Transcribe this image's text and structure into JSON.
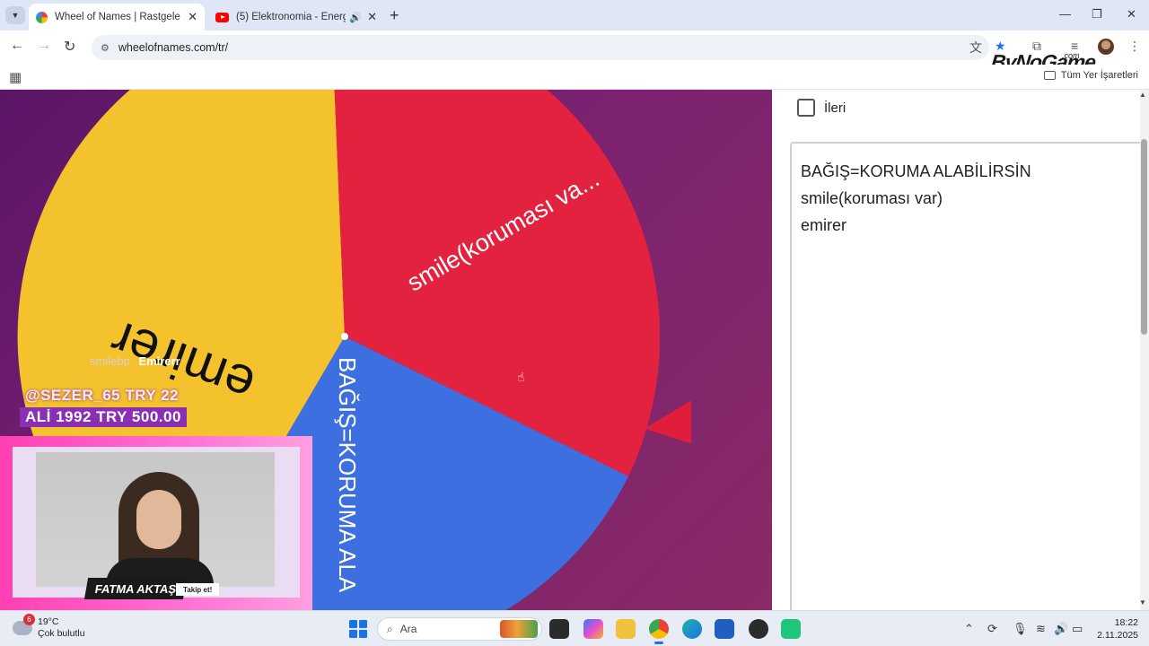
{
  "browser": {
    "tabs": [
      {
        "title": "Wheel of Names | Rastgele",
        "active": true
      },
      {
        "title": "(5) Elektronomia - Energy |",
        "active": false
      }
    ],
    "url": "wheelofnames.com/tr/",
    "bookmarks_bar": {
      "all_bookmarks_label": "Tüm Yer İşaretleri"
    },
    "watermark": {
      "brand": "ByNoGame",
      "suffix": ".com"
    }
  },
  "wheel": {
    "segments": [
      {
        "label": "emirer",
        "color": "#f3c22d"
      },
      {
        "label": "smile(koruması va...",
        "color": "#e3223f"
      },
      {
        "label": "BAĞIŞ=KORUMA ALA",
        "color": "#3d6fe0"
      }
    ],
    "pointer_color": "#e01e3c",
    "background_colors": [
      "#5b1566",
      "#8a2a66"
    ]
  },
  "stream_overlay": {
    "chat": {
      "user": "smilebp",
      "message": "Emirerr"
    },
    "donations": [
      "@SEZER_65  TRY 22",
      "ALİ 1992  TRY 500.00"
    ],
    "streamer_name": "FATMA AKTAŞ",
    "follow_label": "Takip et!"
  },
  "panel": {
    "advanced_checkbox": {
      "label": "İleri",
      "checked": false
    },
    "entries": [
      "BAĞIŞ=KORUMA ALABİLİRSİN",
      "smile(koruması var)",
      "emirer"
    ]
  },
  "taskbar": {
    "weather": {
      "badge": "6",
      "temperature": "19°C",
      "condition": "Çok bulutlu"
    },
    "search_label": "Ara",
    "clock": {
      "time": "18:22",
      "date": "2.11.2025"
    }
  }
}
